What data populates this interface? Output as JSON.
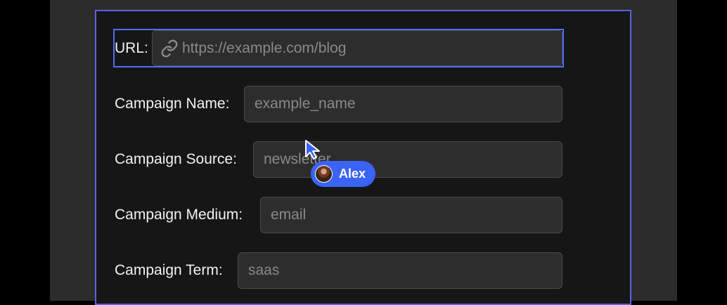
{
  "form": {
    "url": {
      "label": "URL:",
      "placeholder": "https://example.com/blog",
      "icon": "link-icon"
    },
    "campaign_name": {
      "label": "Campaign Name:",
      "placeholder": "example_name"
    },
    "campaign_source": {
      "label": "Campaign Source:",
      "placeholder": "newsletter"
    },
    "campaign_medium": {
      "label": "Campaign Medium:",
      "placeholder": "email"
    },
    "campaign_term": {
      "label": "Campaign Term:",
      "placeholder": "saas"
    }
  },
  "collaborator": {
    "name": "Alex",
    "color": "#3b63f5"
  },
  "colors": {
    "selection": "#4f6ef7",
    "frame_border": "#5a63e6"
  }
}
